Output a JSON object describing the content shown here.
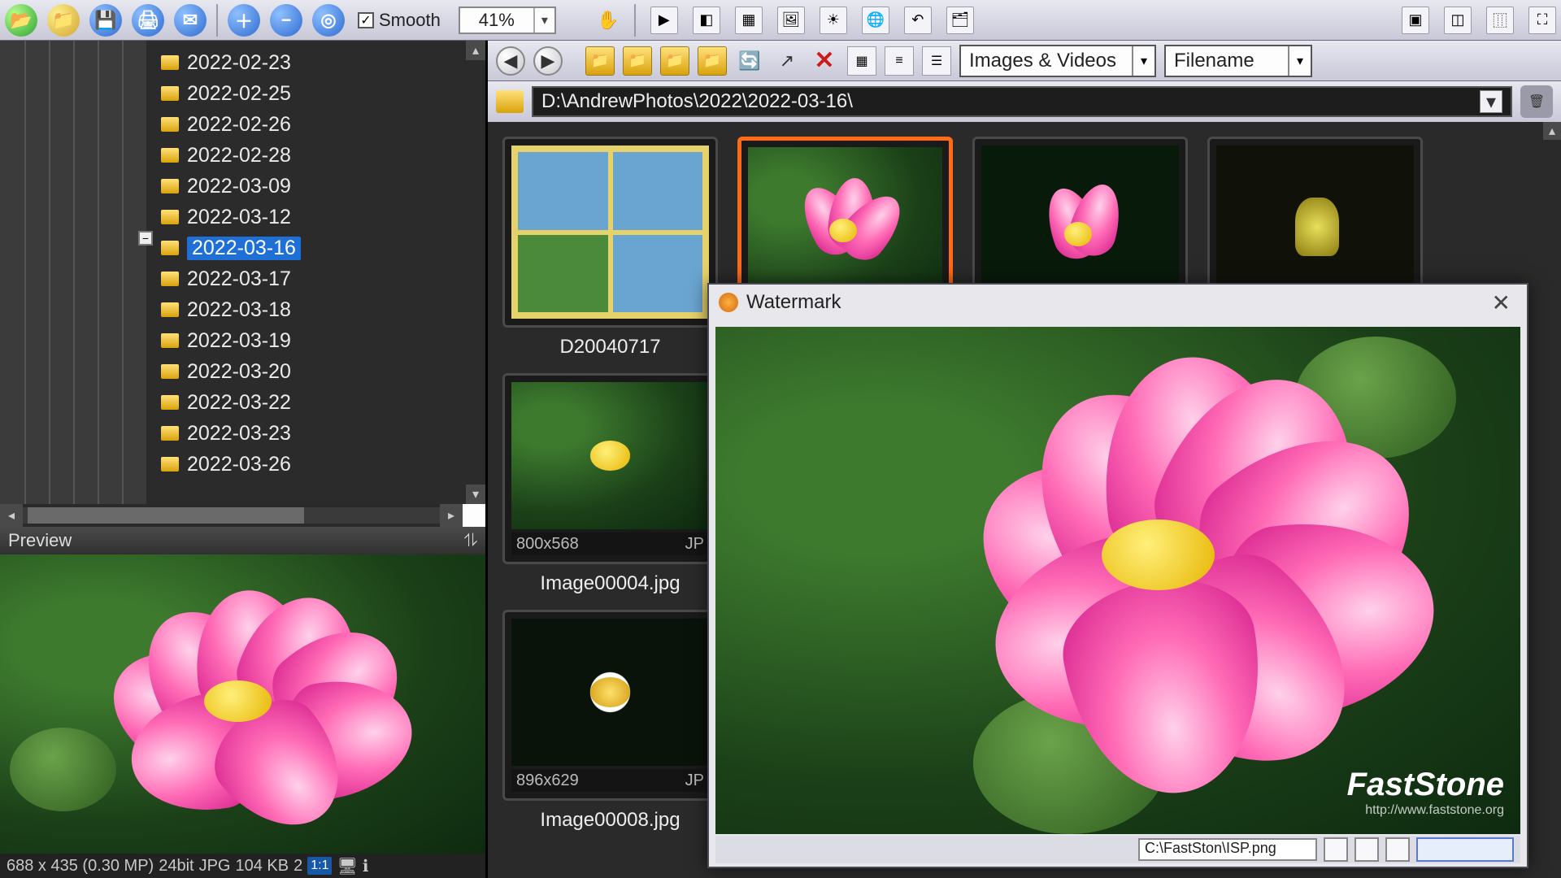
{
  "toolbar": {
    "smooth_label": "Smooth",
    "smooth_checked": "✓",
    "zoom_value": "41%"
  },
  "folders": [
    {
      "name": "2022-02-23"
    },
    {
      "name": "2022-02-25"
    },
    {
      "name": "2022-02-26"
    },
    {
      "name": "2022-02-28"
    },
    {
      "name": "2022-03-09"
    },
    {
      "name": "2022-03-12"
    },
    {
      "name": "2022-03-16",
      "selected": true
    },
    {
      "name": "2022-03-17"
    },
    {
      "name": "2022-03-18"
    },
    {
      "name": "2022-03-19"
    },
    {
      "name": "2022-03-20"
    },
    {
      "name": "2022-03-22"
    },
    {
      "name": "2022-03-23"
    },
    {
      "name": "2022-03-26"
    }
  ],
  "preview": {
    "title": "Preview"
  },
  "status": {
    "dims": "688 x 435 (0.30 MP)",
    "depth": "24bit",
    "fmt": "JPG",
    "size": "104 KB",
    "idx": "2",
    "scale": "1:1"
  },
  "browse": {
    "filter": "Images & Videos",
    "sort": "Filename",
    "path": "D:\\AndrewPhotos\\2022\\2022-03-16\\"
  },
  "thumbs": {
    "t0": {
      "name": "D20040717"
    },
    "t1": {
      "dims": "800x568",
      "ext": "JP",
      "name": "Image00004.jpg"
    },
    "t2": {
      "dims": "896x629",
      "ext": "JP",
      "name": "Image00008.jpg"
    }
  },
  "watermark": {
    "title": "Watermark",
    "brand": "FastStone",
    "brand_sub": "http://www.faststone.org",
    "input": "C:\\FastSton\\ISP.png"
  }
}
